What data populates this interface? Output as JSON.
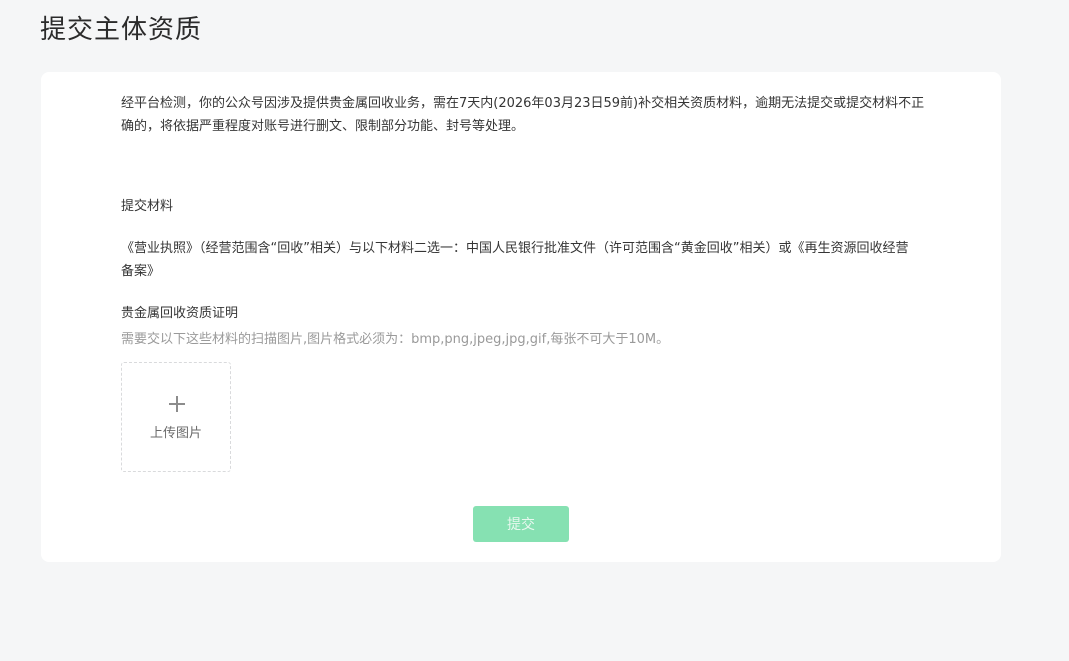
{
  "page": {
    "title": "提交主体资质"
  },
  "notice": {
    "text": "经平台检测，你的公众号因涉及提供贵金属回收业务，需在7天内(2026年03月23日59前)补交相关资质材料，逾期无法提交或提交材料不正确的，将依据严重程度对账号进行删文、限制部分功能、封号等处理。"
  },
  "materials": {
    "section_title": "提交材料",
    "requirement_text": "《营业执照》（经营范围含“回收”相关）与以下材料二选一：中国人民银行批准文件（许可范围含“黄金回收”相关）或《再生资源回收经营备案》"
  },
  "certificate": {
    "title": "贵金属回收资质证明",
    "hint": "需要交以下这些材料的扫描图片,图片格式必须为：bmp,png,jpeg,jpg,gif,每张不可大于10M。",
    "upload_label": "上传图片",
    "upload_icon": "plus-icon"
  },
  "actions": {
    "submit_label": "提交",
    "submit_color": "#86e1b2"
  }
}
